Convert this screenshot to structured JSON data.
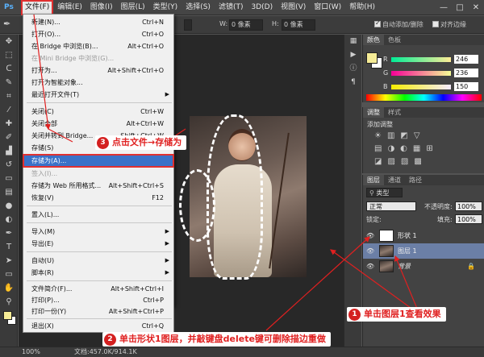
{
  "menubar": {
    "logo": "Ps",
    "items": [
      "文件(F)",
      "编辑(E)",
      "图像(I)",
      "图层(L)",
      "类型(Y)",
      "选择(S)",
      "滤镜(T)",
      "3D(D)",
      "视图(V)",
      "窗口(W)",
      "帮助(H)"
    ],
    "window_controls": [
      "—",
      "□",
      "✕"
    ]
  },
  "options_bar": {
    "w_label": "W:",
    "w_value": "0 像素",
    "h_label": "H:",
    "h_value": "0 像素",
    "auto_add_delete": "自动添加/删除",
    "align_edges": "对齐边缘"
  },
  "file_menu": {
    "items": [
      {
        "label": "新建(N)...",
        "shortcut": "Ctrl+N"
      },
      {
        "label": "打开(O)...",
        "shortcut": "Ctrl+O"
      },
      {
        "label": "在 Bridge 中浏览(B)...",
        "shortcut": "Alt+Ctrl+O"
      },
      {
        "label": "在 Mini Bridge 中浏览(G)...",
        "shortcut": "",
        "disabled": true
      },
      {
        "label": "打开为...",
        "shortcut": "Alt+Shift+Ctrl+O"
      },
      {
        "label": "打开为智能对象...",
        "shortcut": ""
      },
      {
        "label": "最近打开文件(T)",
        "shortcut": "",
        "submenu": true
      },
      {
        "label": "关闭(C)",
        "shortcut": "Ctrl+W"
      },
      {
        "label": "关闭全部",
        "shortcut": "Alt+Ctrl+W"
      },
      {
        "label": "关闭并转到 Bridge...",
        "shortcut": "Shift+Ctrl+W"
      },
      {
        "label": "存储(S)",
        "shortcut": "Ctrl+S"
      },
      {
        "label": "存储为(A)...",
        "shortcut": "Shift+Ctrl+S",
        "highlighted": true
      },
      {
        "label": "签入(I)...",
        "shortcut": "",
        "disabled": true
      },
      {
        "label": "存储为 Web 所用格式...",
        "shortcut": "Alt+Shift+Ctrl+S"
      },
      {
        "label": "恢复(V)",
        "shortcut": "F12"
      },
      {
        "label": "置入(L)...",
        "shortcut": ""
      },
      {
        "label": "导入(M)",
        "shortcut": "",
        "submenu": true
      },
      {
        "label": "导出(E)",
        "shortcut": "",
        "submenu": true
      },
      {
        "label": "自动(U)",
        "shortcut": "",
        "submenu": true
      },
      {
        "label": "脚本(R)",
        "shortcut": "",
        "submenu": true
      },
      {
        "label": "文件简介(F)...",
        "shortcut": "Alt+Shift+Ctrl+I"
      },
      {
        "label": "打印(P)...",
        "shortcut": "Ctrl+P"
      },
      {
        "label": "打印一份(Y)",
        "shortcut": "Alt+Shift+Ctrl+P"
      },
      {
        "label": "退出(X)",
        "shortcut": "Ctrl+Q"
      }
    ]
  },
  "color_panel": {
    "tabs": [
      "颜色",
      "色板"
    ],
    "r_label": "R",
    "r_value": "246",
    "g_label": "G",
    "g_value": "236",
    "b_label": "B",
    "b_value": "150",
    "foreground_color": "#f6ec96"
  },
  "adjustments_panel": {
    "tabs": [
      "调整",
      "样式"
    ],
    "title": "添加调整"
  },
  "layers_panel": {
    "tabs": [
      "图层",
      "通道",
      "路径"
    ],
    "kind_filter": "类型",
    "blend_mode": "正常",
    "opacity_label": "不透明度:",
    "opacity_value": "100%",
    "lock_label": "锁定:",
    "fill_label": "填充:",
    "fill_value": "100%",
    "layers": [
      {
        "name": "形状 1",
        "selected": false
      },
      {
        "name": "图层 1",
        "selected": true
      },
      {
        "name": "背景",
        "selected": false,
        "locked": true
      }
    ]
  },
  "status_bar": {
    "zoom": "100%",
    "doc_info": "文档:457.0K/914.1K"
  },
  "callouts": {
    "c1_num": "1",
    "c1_text": "单击图层1查看效果",
    "c2_num": "2",
    "c2_text": "单击形状1图层，并敲键盘delete键可删除描边重做",
    "c3_num": "3",
    "c3_text": "点击文件→存储为"
  },
  "colors": {
    "accent_red": "#e02020",
    "menu_highlight": "#3a72c8",
    "panel_bg": "#434343"
  }
}
